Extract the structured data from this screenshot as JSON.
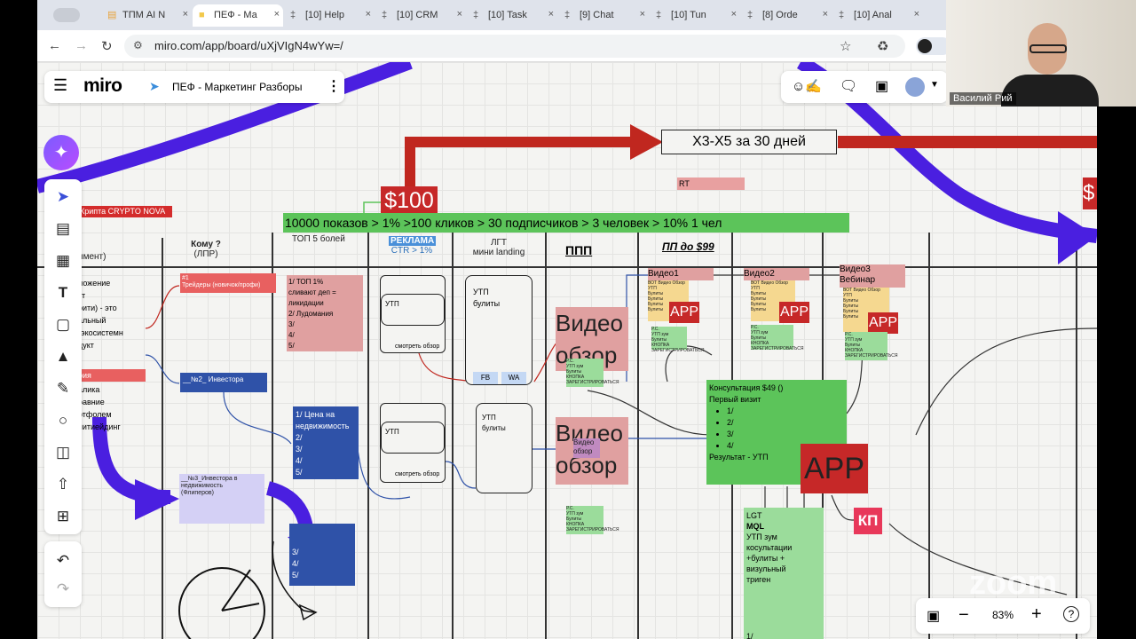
{
  "browser": {
    "tabs": [
      {
        "label": "ТПМ AI N",
        "icon": "doc-icon",
        "active": false
      },
      {
        "label": "ПЕФ - Ма",
        "icon": "miro-icon",
        "active": true
      },
      {
        "label": "[10] Help",
        "icon": "bitrix-icon",
        "active": false
      },
      {
        "label": "[10] CRM",
        "icon": "bitrix-icon",
        "active": false
      },
      {
        "label": "[10] Task",
        "icon": "bitrix-icon",
        "active": false
      },
      {
        "label": "[9] Chat",
        "icon": "bitrix-icon",
        "active": false
      },
      {
        "label": "[10] Tun",
        "icon": "bitrix-icon",
        "active": false
      },
      {
        "label": "[8] Orde",
        "icon": "bitrix-icon",
        "active": false
      },
      {
        "label": "[10] Anal",
        "icon": "bitrix-icon",
        "active": false
      }
    ],
    "url": "miro.com/app/board/uXjVIgN4wYw=/"
  },
  "miro": {
    "logo": "miro",
    "board_title": "ПЕФ - Маркетинг Разборы",
    "zoom": "83%"
  },
  "zoom_user": {
    "name": "Василий Рий",
    "watermark": "zoom"
  },
  "board": {
    "goal": "Х3-Х5 за 30 дней",
    "price_main": "$100",
    "price_right": "$",
    "rt_label": "RT",
    "funnel_banner": "10000 показов > 1% >100 кликов > 30 подписчиков > 3 человек > 10% 1 чел",
    "headers": {
      "segment": "имент)",
      "whom": "Кому ?",
      "whom_sub": "(ЛПР)",
      "top5": "ТОП 5 болей",
      "ads": "РЕКЛАМА",
      "ctr": "CTR > 1%",
      "lgt": "ЛГТ",
      "lgt_sub": "мини landing",
      "ppp": "ППП",
      "pp99": "ПП до $99"
    },
    "crypto_label": "Крипта CRYPTO NOVA",
    "left_text": "ложение\nкт\nрити) - это\nальный\n-экосистемн\nдукт",
    "left_red": "рия",
    "left_text2": "алика\nравние\nртфолем\nпитиейдинг",
    "traders": "#1\nТрейдеры (новичок/профи)",
    "investor2": "__№2_ Инвестора",
    "investor3": "__№3_Инвестора в\nнедвижимость\n(Флиперов)",
    "pains1": "1/ ТОП 1%\nсливают деп =\nликидации\n2/ Лудомания\n3/\n4/\n5/",
    "pains2": "1/ Цена на\nнедвижимость\n2/\n3/\n4/\n5/",
    "pains3": "3/\n4/\n5/",
    "utp1": "УТП",
    "utp1_link": "смотреть обзор",
    "utp2": "УТП",
    "utp2_link": "смотреть обзор",
    "lgt1": "УТП\nбулиты",
    "lgt1_fb": "FB",
    "lgt1_wa": "WA",
    "lgt2": "УТП\nбулиты",
    "video_review": "Видео\nобзор",
    "video_review2": "Видео\nобзор",
    "video_small": "Видео\nобзор",
    "video1": "Видео1",
    "video2": "Видео2",
    "video3": "Видео3\nВебинар",
    "app": "APP",
    "video_tiny": "ВОТ Видео Обзор\nУТП\nБулиты\nБулиты\nБулиты\nБулиты",
    "green_tiny": "Р.С.\nУТП зум\nБулиты\nКНОПКА\nЗАРЕГИСТРИРОВАТЬСЯ",
    "consult": "Консультация $49 ()\nПервый визит",
    "consult_items": [
      "1/",
      "2/",
      "3/",
      "4/"
    ],
    "consult_result": "Результат - УТП",
    "app_big": "APP",
    "kp": "КП",
    "lgt_bottom_title": "LGT",
    "lgt_bottom_mql": "MQL",
    "lgt_bottom_text": "УТП зум косультации\n+булиты + визульный\nтриген",
    "lgt_bottom_list": "1/\n2/\n3/"
  },
  "colors": {
    "purple": "#4a1fe0",
    "red_arrow": "#c0271f",
    "green": "#5cc45a",
    "blue": "#2f52a8",
    "pink": "#e8a0a0",
    "red": "#c62828"
  }
}
